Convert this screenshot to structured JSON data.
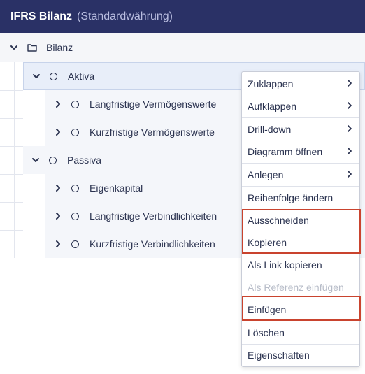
{
  "header": {
    "title": "IFRS Bilanz",
    "subtitle": "(Standardwährung)"
  },
  "tree": {
    "root": {
      "label": "Bilanz",
      "icon": "folder-icon"
    },
    "nodes": [
      {
        "label": "Aktiva",
        "level": 1,
        "state": "expanded"
      },
      {
        "label": "Langfristige Vermögenswerte",
        "level": 2,
        "state": "collapsed"
      },
      {
        "label": "Kurzfristige Vermögenswerte",
        "level": 2,
        "state": "collapsed"
      },
      {
        "label": "Passiva",
        "level": 1,
        "state": "expanded"
      },
      {
        "label": "Eigenkapital",
        "level": 2,
        "state": "collapsed"
      },
      {
        "label": "Langfristige Verbindlichkeiten",
        "level": 2,
        "state": "collapsed"
      },
      {
        "label": "Kurzfristige Verbindlichkeiten",
        "level": 2,
        "state": "collapsed"
      }
    ]
  },
  "context_menu": {
    "items": [
      {
        "label": "Zuklappen",
        "submenu": true
      },
      {
        "label": "Aufklappen",
        "submenu": true
      },
      {
        "label": "Drill-down",
        "submenu": true
      },
      {
        "label": "Diagramm öffnen",
        "submenu": true
      },
      {
        "label": "Anlegen",
        "submenu": true
      },
      {
        "label": "Reihenfolge ändern"
      },
      {
        "label": "Ausschneiden",
        "highlighted": true
      },
      {
        "label": "Kopieren",
        "highlighted": true
      },
      {
        "label": "Als Link kopieren"
      },
      {
        "label": "Als Referenz einfügen",
        "disabled": true
      },
      {
        "label": "Einfügen",
        "highlighted": true
      },
      {
        "label": "Löschen"
      },
      {
        "label": "Eigenschaften"
      }
    ]
  },
  "colors": {
    "header_bg": "#2a3166",
    "selected_row": "#e8eef9",
    "highlight_border": "#c9432e",
    "disabled_text": "#b7bcc8"
  }
}
